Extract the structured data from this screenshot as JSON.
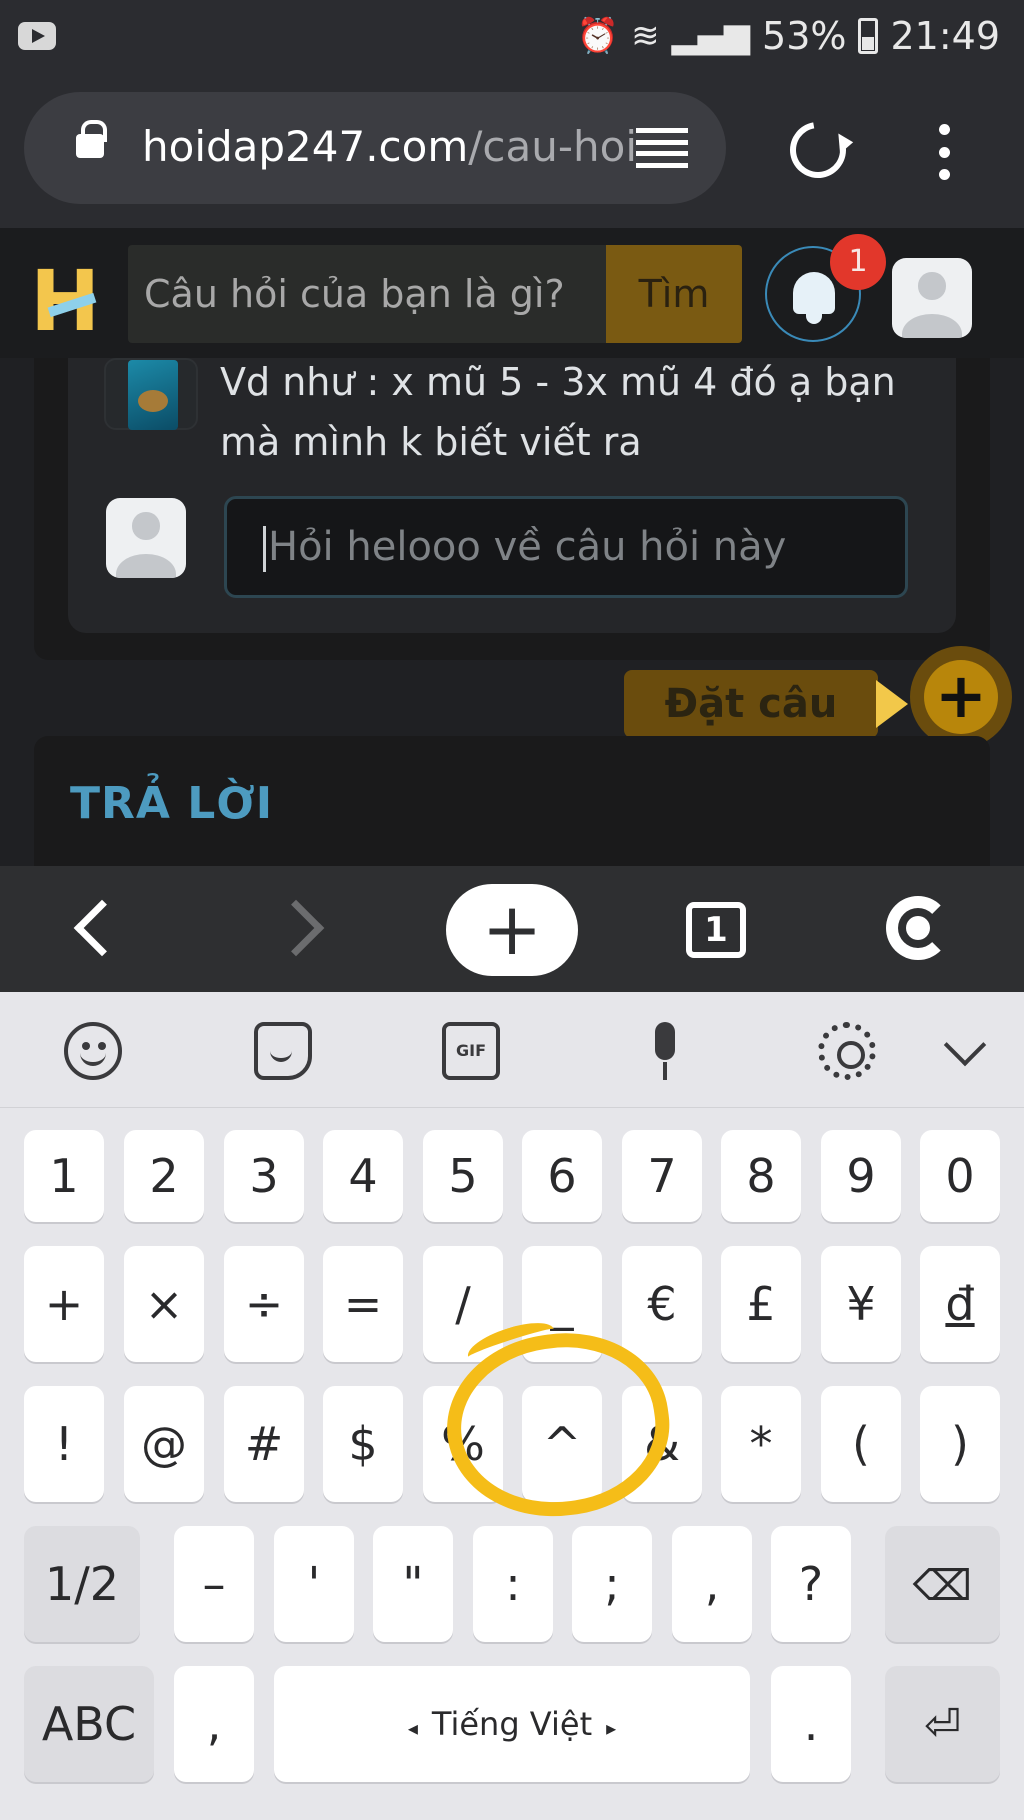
{
  "status_bar": {
    "battery": "53%",
    "time": "21:49"
  },
  "browser": {
    "url_domain": "hoidap247.com",
    "url_path": "/cau-hoi"
  },
  "site": {
    "search_placeholder": "Câu hỏi của bạn là gì?",
    "search_button": "Tìm",
    "notification_count": "1"
  },
  "question": {
    "comment_line1": "Vd như : x mũ 5 - 3x mũ 4 đó ạ bạn",
    "comment_line2": "mà mình k biết viết ra",
    "reply_placeholder": "Hỏi helooo về câu hỏi này"
  },
  "fab": {
    "label": "Đặt câu hỏi",
    "plus": "+"
  },
  "answers": {
    "heading": "TRẢ LỜI"
  },
  "bottom_toolbar": {
    "new_tab": "+",
    "tab_count": "1"
  },
  "keyboard": {
    "row1": [
      "1",
      "2",
      "3",
      "4",
      "5",
      "6",
      "7",
      "8",
      "9",
      "0"
    ],
    "row2": [
      "+",
      "×",
      "÷",
      "=",
      "/",
      "_",
      "€",
      "£",
      "¥",
      "đ"
    ],
    "row3": [
      "!",
      "@",
      "#",
      "$",
      "%",
      "^",
      "&",
      "*",
      "(",
      ")"
    ],
    "row4": [
      "1/2",
      "–",
      "'",
      "\"",
      ":",
      ";",
      ",",
      "?"
    ],
    "abc": "ABC",
    "comma": ",",
    "space": "Tiếng Việt",
    "period": ".",
    "gif": "GIF"
  },
  "annotation_color": "#f5bd18"
}
